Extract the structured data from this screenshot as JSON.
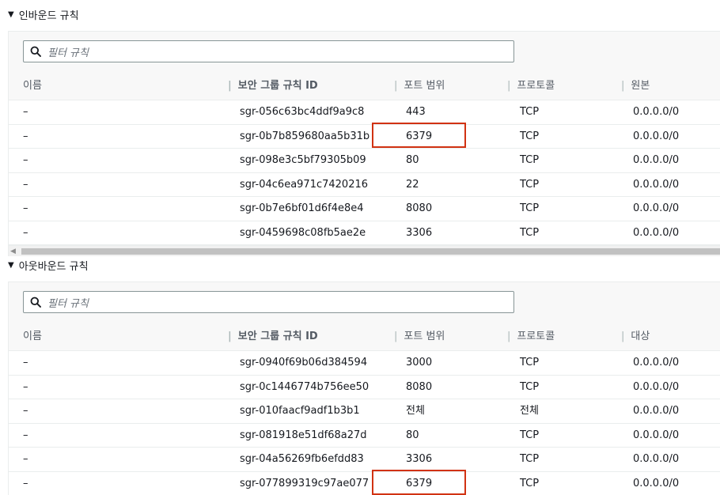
{
  "inbound": {
    "title": "인바운드 규칙",
    "filter_placeholder": "필터 규칙",
    "columns": [
      "이름",
      "보안 그룹 규칙 ID",
      "포트 범위",
      "프로토콜",
      "원본"
    ],
    "rows": [
      {
        "name": "–",
        "id": "sgr-056c63bc4ddf9a9c8",
        "port": "443",
        "protocol": "TCP",
        "target": "0.0.0.0/0"
      },
      {
        "name": "–",
        "id": "sgr-0b7b859680aa5b31b",
        "port": "6379",
        "protocol": "TCP",
        "target": "0.0.0.0/0"
      },
      {
        "name": "–",
        "id": "sgr-098e3c5bf79305b09",
        "port": "80",
        "protocol": "TCP",
        "target": "0.0.0.0/0"
      },
      {
        "name": "–",
        "id": "sgr-04c6ea971c7420216",
        "port": "22",
        "protocol": "TCP",
        "target": "0.0.0.0/0"
      },
      {
        "name": "–",
        "id": "sgr-0b7e6bf01d6f4e8e4",
        "port": "8080",
        "protocol": "TCP",
        "target": "0.0.0.0/0"
      },
      {
        "name": "–",
        "id": "sgr-0459698c08fb5ae2e",
        "port": "3306",
        "protocol": "TCP",
        "target": "0.0.0.0/0"
      }
    ]
  },
  "outbound": {
    "title": "아웃바운드 규칙",
    "filter_placeholder": "필터 규칙",
    "columns": [
      "이름",
      "보안 그룹 규칙 ID",
      "포트 범위",
      "프로토콜",
      "대상"
    ],
    "rows": [
      {
        "name": "–",
        "id": "sgr-0940f69b06d384594",
        "port": "3000",
        "protocol": "TCP",
        "target": "0.0.0.0/0"
      },
      {
        "name": "–",
        "id": "sgr-0c1446774b756ee50",
        "port": "8080",
        "protocol": "TCP",
        "target": "0.0.0.0/0"
      },
      {
        "name": "–",
        "id": "sgr-010faacf9adf1b3b1",
        "port": "전체",
        "protocol": "전체",
        "target": "0.0.0.0/0"
      },
      {
        "name": "–",
        "id": "sgr-081918e51df68a27d",
        "port": "80",
        "protocol": "TCP",
        "target": "0.0.0.0/0"
      },
      {
        "name": "–",
        "id": "sgr-04a56269fb6efdd83",
        "port": "3306",
        "protocol": "TCP",
        "target": "0.0.0.0/0"
      },
      {
        "name": "–",
        "id": "sgr-077899319c97ae077",
        "port": "6379",
        "protocol": "TCP",
        "target": "0.0.0.0/0"
      }
    ]
  },
  "icons": {
    "caret": "caret-down-icon",
    "search": "search-icon",
    "scroll_left": "scroll-left-arrow-icon"
  },
  "colors": {
    "highlight": "#d13212",
    "header_bg": "#f8f8f8",
    "border": "#eaeded"
  }
}
